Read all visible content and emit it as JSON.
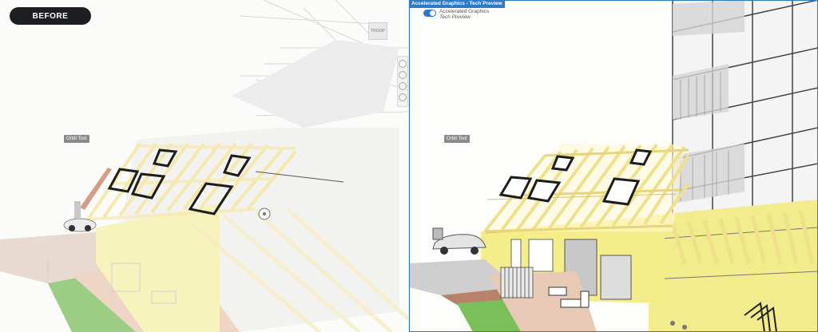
{
  "left_view": {
    "badge": "BEFORE",
    "orbit_tooltip": "Orbit Tool",
    "viewcube_label": "TROOP"
  },
  "right_view": {
    "title": "Accelerated Graphics - Tech Preview",
    "toggle": {
      "label": "Accelerated Graphics",
      "sublabel": "Tech Preview",
      "on": true
    },
    "orbit_tooltip": "Orbit Tool"
  },
  "colors": {
    "accent": "#2e78c9",
    "rafter_faded": "#f6eebf",
    "rafter_solid": "#f1e49a",
    "wall_yellow": "#f3ee8a",
    "grass": "#7bbf5a",
    "path": "#c9a48f"
  }
}
